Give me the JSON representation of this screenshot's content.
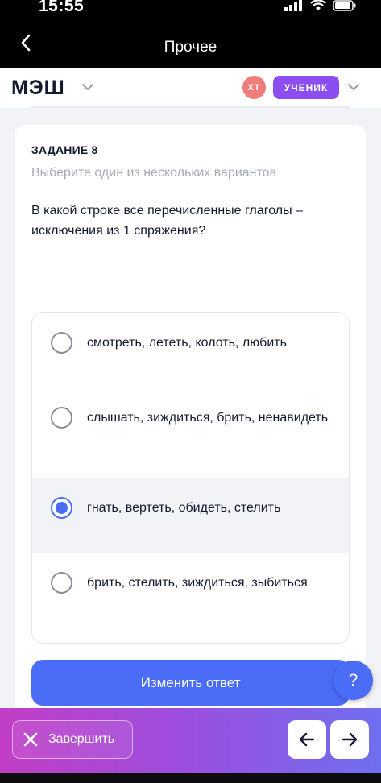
{
  "status_bar": {
    "time": "15:55"
  },
  "nav_bar": {
    "title": "Прочее",
    "back_icon": "chevron-left-icon"
  },
  "header": {
    "brand": "МЭШ",
    "avatar_initials": "ХТ",
    "role": "УЧЕНИК",
    "colors": {
      "avatar": "#f07c7c",
      "role_badge": "#8c4ef0"
    }
  },
  "task": {
    "number_label": "ЗАДАНИЕ 8",
    "hint": "Выберите один из нескольких вариантов",
    "question": "В какой строке все перечисленные глаголы – исключения из 1 спряжения?",
    "options": [
      {
        "label": "смотреть, лететь, колоть, любить",
        "selected": false
      },
      {
        "label": "слышать, зиждиться, брить, ненавидеть",
        "selected": false
      },
      {
        "label": "гнать, вертеть, обидеть, стелить",
        "selected": true
      },
      {
        "label": "брить, стелить, зиждиться, зыбиться",
        "selected": false
      }
    ]
  },
  "actions": {
    "change_answer": "Изменить ответ",
    "help": "?",
    "finish": "Завершить"
  },
  "colors": {
    "accent": "#4a6cf7",
    "gradient_start": "#c23ec6",
    "gradient_end": "#6f6ff0"
  }
}
